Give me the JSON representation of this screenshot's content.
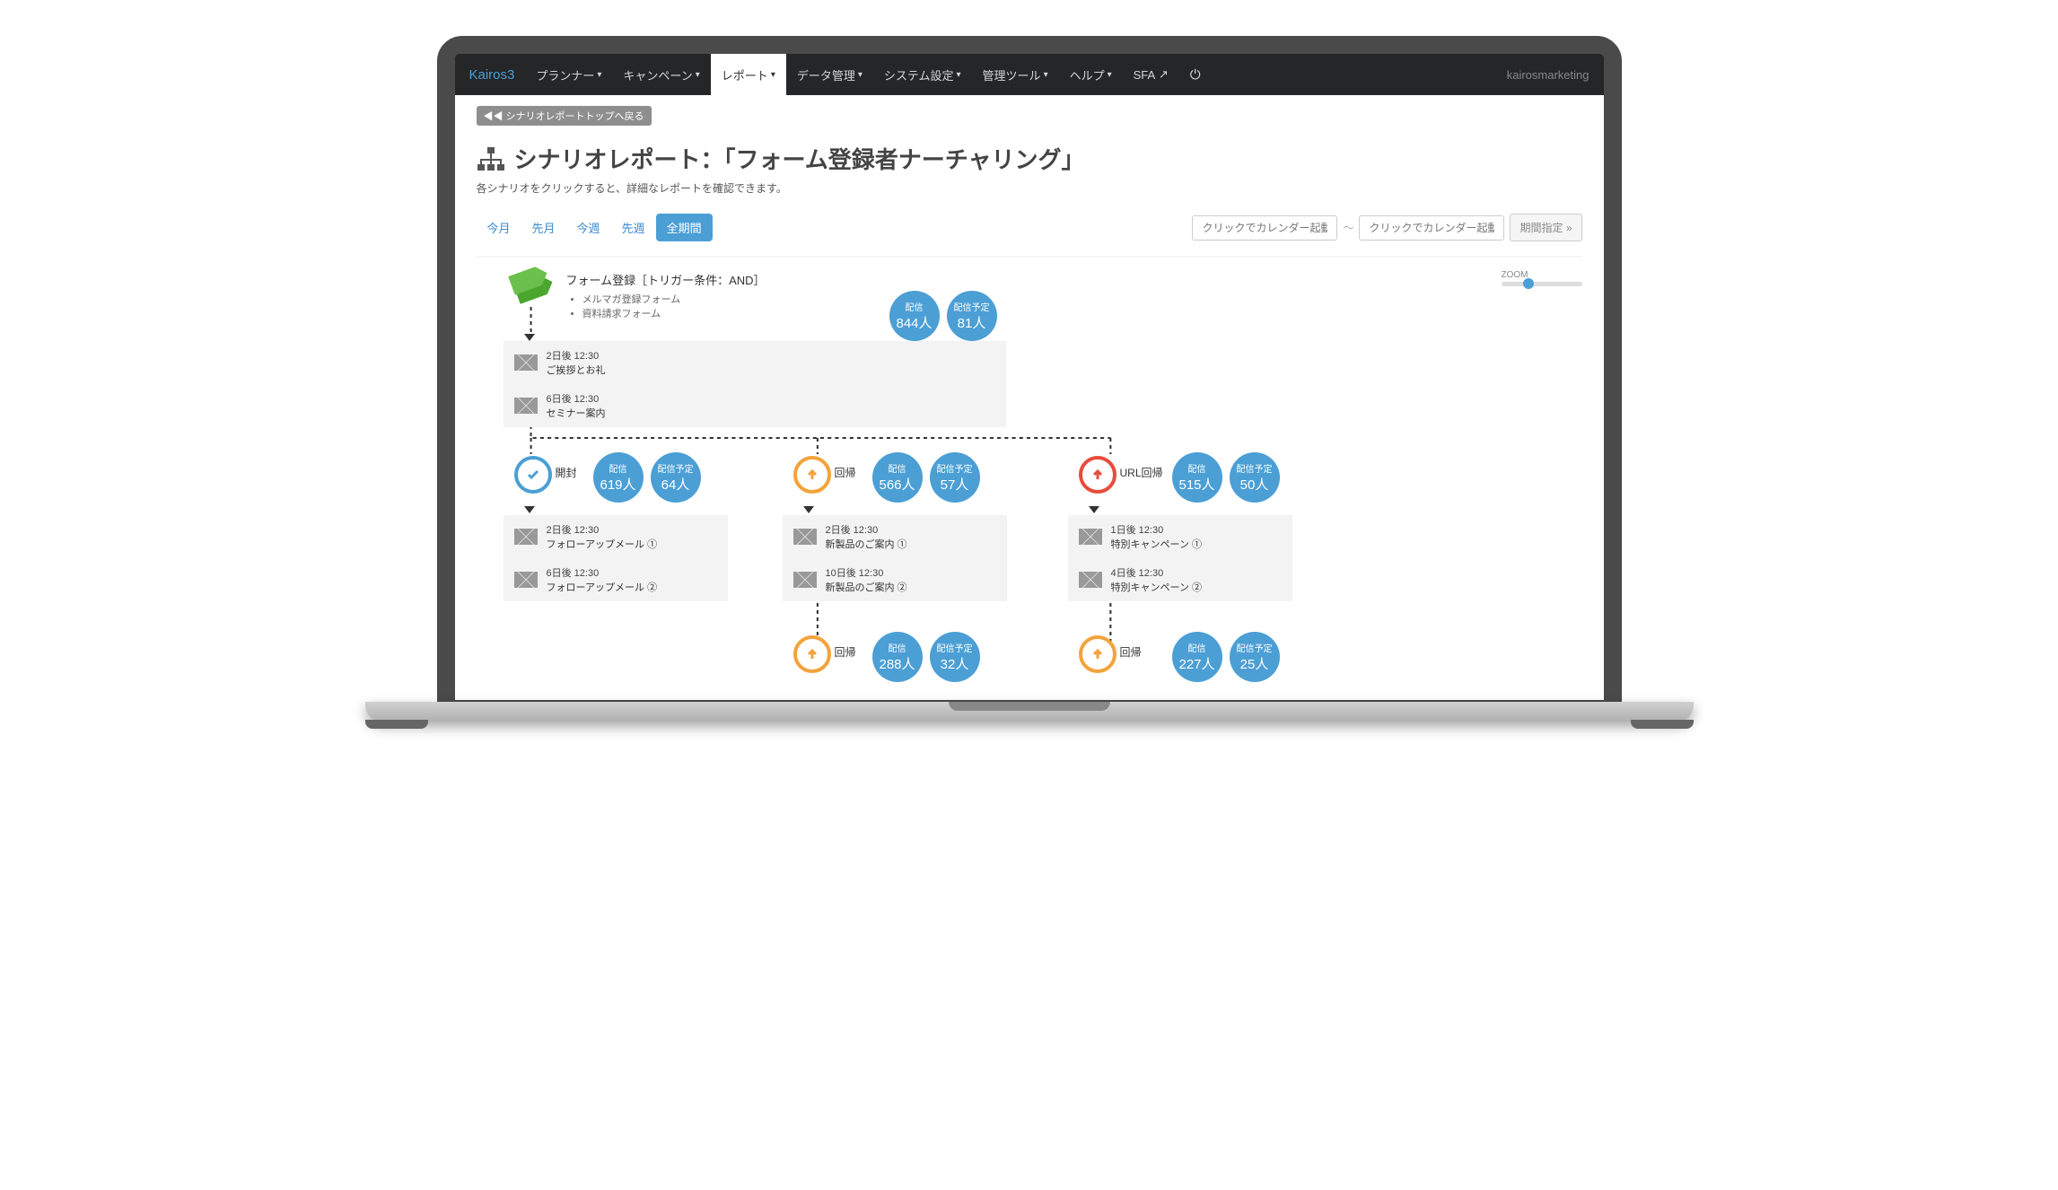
{
  "nav": {
    "brand": "Kairos3",
    "items": [
      "プランナー",
      "キャンペーン",
      "レポート",
      "データ管理",
      "システム設定",
      "管理ツール",
      "ヘルプ"
    ],
    "active_index": 2,
    "sfa": "SFA",
    "user": "kairosmarketing"
  },
  "back_link": "◀◀ シナリオレポートトップへ戻る",
  "page": {
    "title": "シナリオレポート：「フォーム登録者ナーチャリング」",
    "subtitle": "各シナリオをクリックすると、詳細なレポートを確認できます。"
  },
  "period": {
    "tabs": [
      "今月",
      "先月",
      "今週",
      "先週",
      "全期間"
    ],
    "active_index": 4,
    "calendar_placeholder": "クリックでカレンダー起動",
    "range_button": "期間指定 »"
  },
  "zoom_label": "ZOOM",
  "trigger": {
    "title": "フォーム登録［トリガー条件：AND］",
    "items": [
      "メルマガ登録フォーム",
      "資料請求フォーム"
    ]
  },
  "top_bubbles": {
    "sent": {
      "label": "配信",
      "value": "844人"
    },
    "scheduled": {
      "label": "配信予定",
      "value": "81人"
    }
  },
  "step1": {
    "rows": [
      {
        "time": "2日後 12:30",
        "name": "ご挨拶とお礼"
      },
      {
        "time": "6日後 12:30",
        "name": "セミナー案内"
      }
    ]
  },
  "branches": [
    {
      "kind": "open",
      "label": "開封",
      "sent": {
        "label": "配信",
        "value": "619人"
      },
      "scheduled": {
        "label": "配信予定",
        "value": "64人"
      },
      "rows": [
        {
          "time": "2日後 12:30",
          "name": "フォローアップメール ①"
        },
        {
          "time": "6日後 12:30",
          "name": "フォローアップメール ②"
        }
      ]
    },
    {
      "kind": "return",
      "label": "回帰",
      "sent": {
        "label": "配信",
        "value": "566人"
      },
      "scheduled": {
        "label": "配信予定",
        "value": "57人"
      },
      "rows": [
        {
          "time": "2日後 12:30",
          "name": "新製品のご案内 ①"
        },
        {
          "time": "10日後 12:30",
          "name": "新製品のご案内 ②"
        }
      ]
    },
    {
      "kind": "url",
      "label": "URL回帰",
      "sent": {
        "label": "配信",
        "value": "515人"
      },
      "scheduled": {
        "label": "配信予定",
        "value": "50人"
      },
      "rows": [
        {
          "time": "1日後 12:30",
          "name": "特別キャンペーン ①"
        },
        {
          "time": "4日後 12:30",
          "name": "特別キャンペーン ②"
        }
      ]
    }
  ],
  "lower": [
    {
      "label": "回帰",
      "sent": {
        "label": "配信",
        "value": "288人"
      },
      "scheduled": {
        "label": "配信予定",
        "value": "32人"
      }
    },
    {
      "label": "回帰",
      "sent": {
        "label": "配信",
        "value": "227人"
      },
      "scheduled": {
        "label": "配信予定",
        "value": "25人"
      }
    }
  ]
}
